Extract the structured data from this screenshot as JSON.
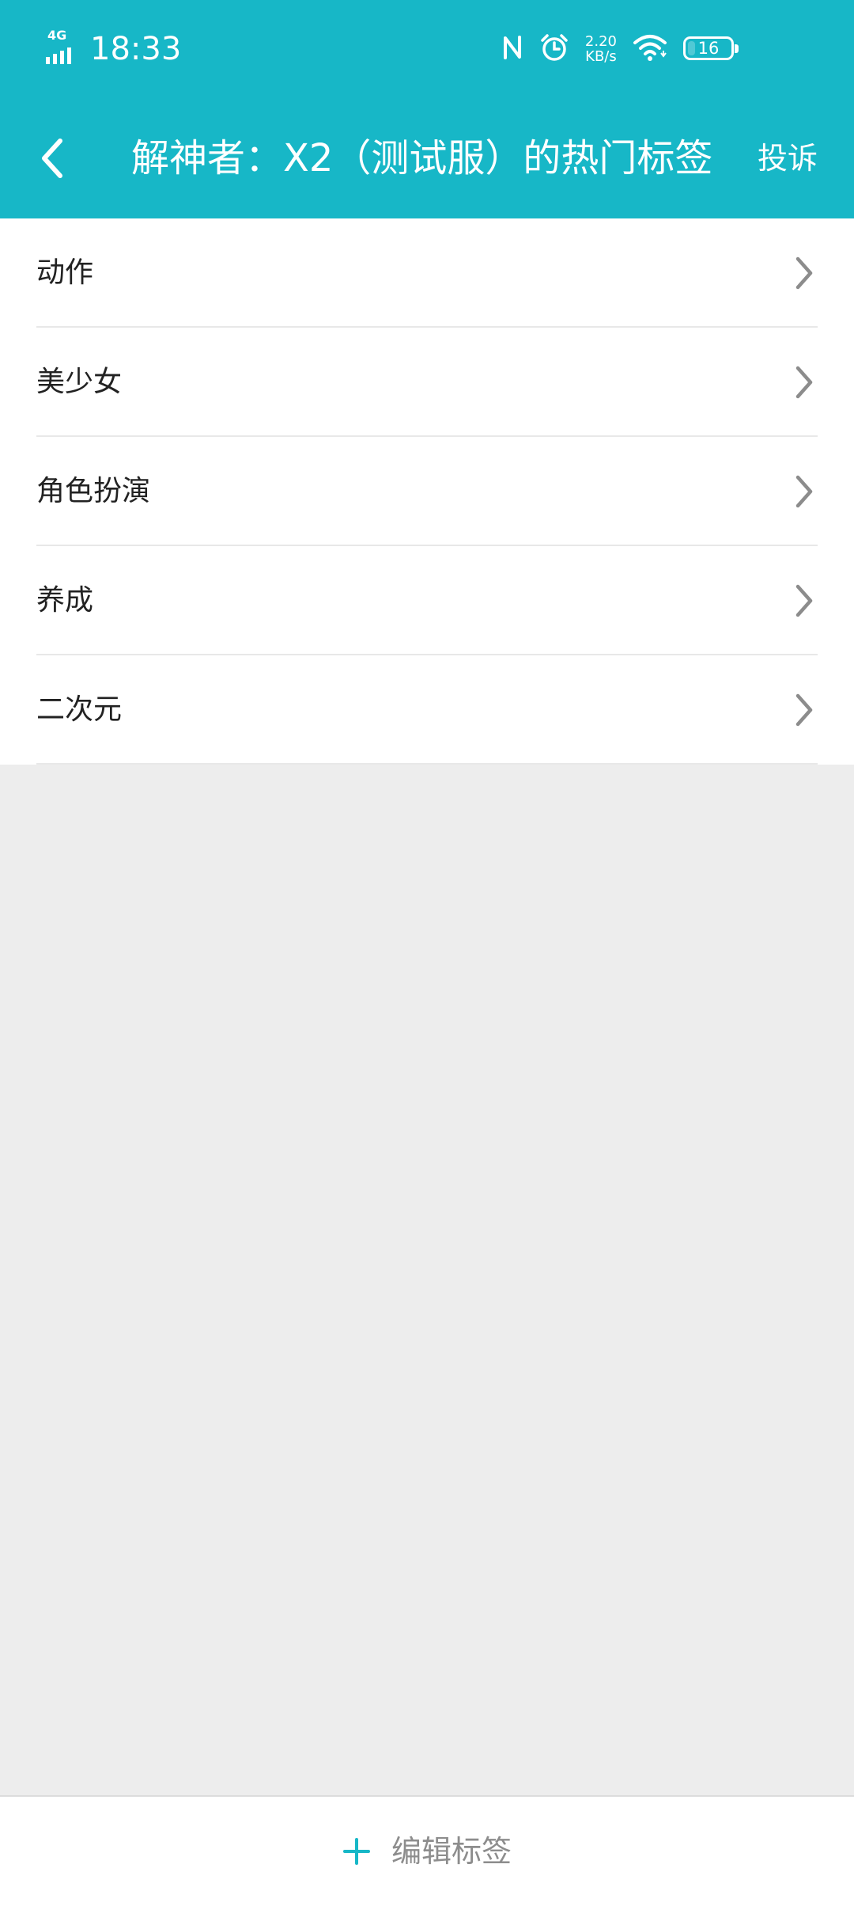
{
  "status_bar": {
    "network": "4G",
    "time": "18:33",
    "speed_value": "2.20",
    "speed_unit": "KB/s",
    "battery": "16"
  },
  "header": {
    "title": "解神者：X2（测试服）的热门标签",
    "report_label": "投诉"
  },
  "tags": [
    {
      "label": "动作"
    },
    {
      "label": "美少女"
    },
    {
      "label": "角色扮演"
    },
    {
      "label": "养成"
    },
    {
      "label": "二次元"
    }
  ],
  "bottom_bar": {
    "edit_label": "编辑标签"
  },
  "colors": {
    "accent": "#17b7c7",
    "background": "#ededed"
  }
}
